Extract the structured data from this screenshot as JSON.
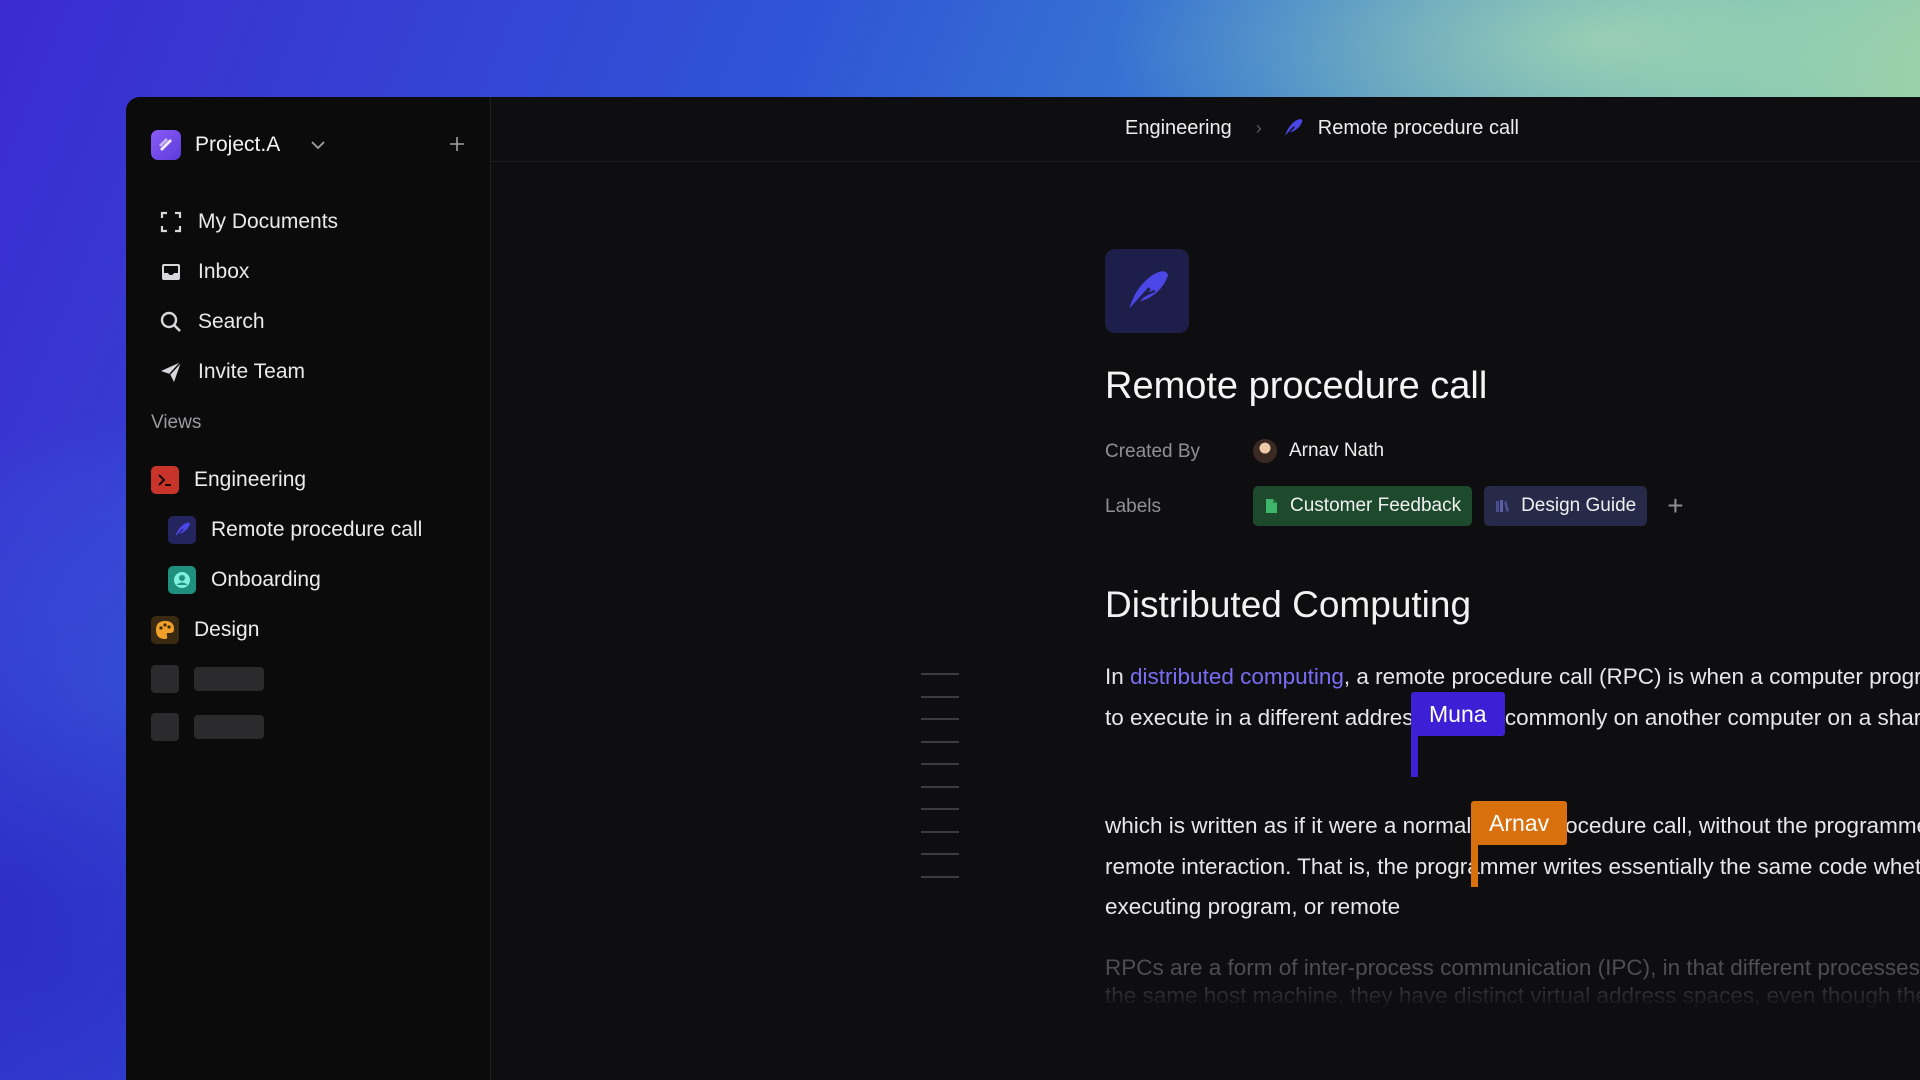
{
  "workspace": {
    "name": "Project.A"
  },
  "nav": [
    {
      "label": "My Documents",
      "icon": "focus-frame-icon"
    },
    {
      "label": "Inbox",
      "icon": "inbox-icon"
    },
    {
      "label": "Search",
      "icon": "search-icon"
    },
    {
      "label": "Invite Team",
      "icon": "send-icon"
    }
  ],
  "views": {
    "label": "Views",
    "items": [
      {
        "label": "Engineering",
        "icon": "terminal-icon",
        "color": "#c8332a"
      },
      {
        "label": "Remote procedure call",
        "icon": "feather-icon",
        "color": "#2a2a6a"
      },
      {
        "label": "Onboarding",
        "icon": "person-icon",
        "color": "#1f8f7e"
      },
      {
        "label": "Design",
        "icon": "palette-icon",
        "color": "#f0a12b"
      }
    ]
  },
  "breadcrumb": {
    "parent": "Engineering",
    "current": "Remote procedure call"
  },
  "doc": {
    "title": "Remote procedure call",
    "created_by_label": "Created By",
    "created_by": "Arnav Nath",
    "labels_label": "Labels",
    "labels": [
      {
        "text": "Customer Feedback",
        "color": "#1d4a2c"
      },
      {
        "text": "Design Guide",
        "color": "#262a48"
      }
    ],
    "heading": "Distributed Computing",
    "p1_pre": "In ",
    "p1_link": "distributed computing",
    "p1_rest": ", a remote procedure call (RPC) is when a computer program causes a procedure (subroutine) to execute in a different address space (commonly on another computer on a shared computer network)",
    "p2": "which is written as if it were a normal (local) procedure call, without the programmer explicitly writing the details for the remote interaction. That is, the programmer writes essentially the same code whether the subroutine is local to the executing program, or remote",
    "p3": "RPCs are a form of inter-process communication (IPC), in that different processes have different address spaces: if on the same host machine, they have distinct virtual address spaces, even though the physical"
  },
  "collaborators": [
    {
      "name": "Muna",
      "color": "#3d1fd6"
    },
    {
      "name": "Arnav",
      "color": "#d9700e"
    }
  ]
}
